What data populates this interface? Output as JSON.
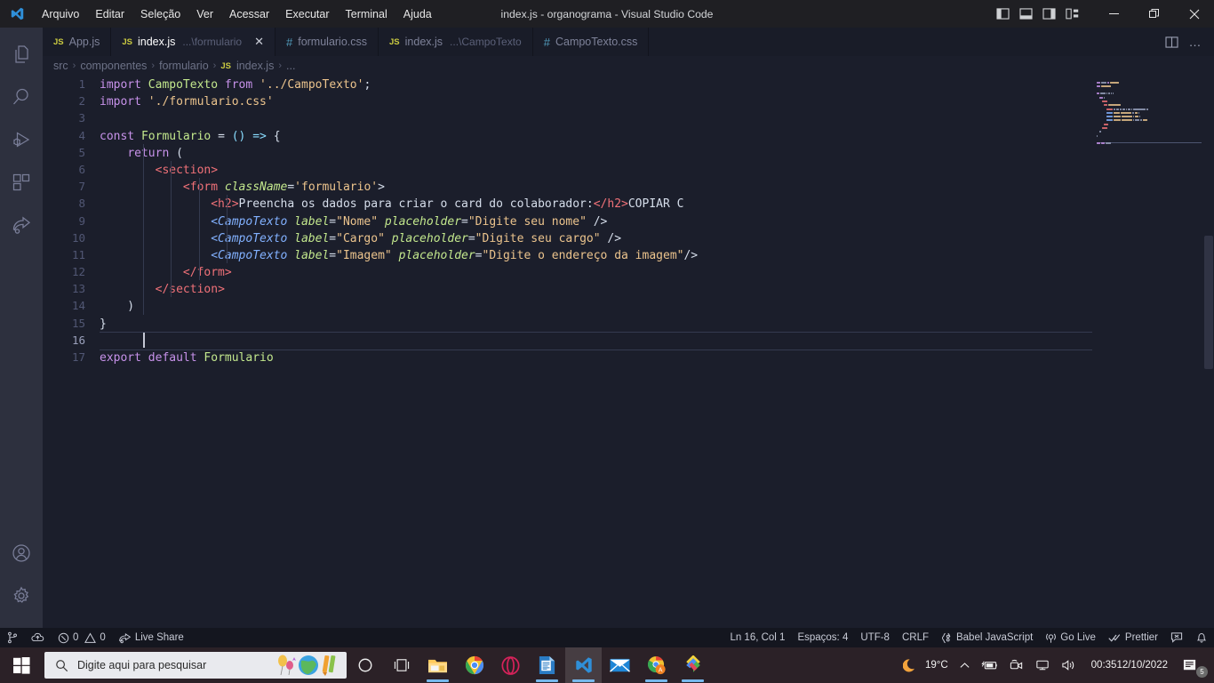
{
  "window": {
    "title": "index.js - organograma - Visual Studio Code",
    "minimize_label": "—",
    "maximize_label": "❐",
    "close_label": "✕"
  },
  "menu": {
    "items": [
      {
        "label": "Arquivo",
        "name": "menu-arquivo"
      },
      {
        "label": "Editar",
        "name": "menu-editar"
      },
      {
        "label": "Seleção",
        "name": "menu-selecao"
      },
      {
        "label": "Ver",
        "name": "menu-ver"
      },
      {
        "label": "Acessar",
        "name": "menu-acessar"
      },
      {
        "label": "Executar",
        "name": "menu-executar"
      },
      {
        "label": "Terminal",
        "name": "menu-terminal"
      },
      {
        "label": "Ajuda",
        "name": "menu-ajuda"
      }
    ]
  },
  "layout_controls": [
    {
      "name": "toggle-primary-sidebar-icon"
    },
    {
      "name": "toggle-panel-icon"
    },
    {
      "name": "toggle-secondary-sidebar-icon"
    },
    {
      "name": "customize-layout-icon"
    }
  ],
  "activity_bar": {
    "items": [
      {
        "name": "explorer-icon",
        "label": "Explorer"
      },
      {
        "name": "search-icon",
        "label": "Pesquisar"
      },
      {
        "name": "run-and-debug-icon",
        "label": "Executar e Depurar"
      },
      {
        "name": "extensions-icon",
        "label": "Extensões"
      },
      {
        "name": "live-share-icon",
        "label": "Live Share"
      }
    ],
    "bottom_items": [
      {
        "name": "account-icon",
        "label": "Conta"
      },
      {
        "name": "settings-gear-icon",
        "label": "Gerenciar"
      }
    ]
  },
  "tabs": [
    {
      "badge": "JS",
      "badge_type": "js",
      "name": "App.js",
      "path": "",
      "active": false,
      "closable": false
    },
    {
      "badge": "JS",
      "badge_type": "js",
      "name": "index.js",
      "path": "...\\formulario",
      "active": true,
      "closable": true,
      "close_label": "✕"
    },
    {
      "badge": "#",
      "badge_type": "css",
      "name": "formulario.css",
      "path": "",
      "active": false,
      "closable": false
    },
    {
      "badge": "JS",
      "badge_type": "js",
      "name": "index.js",
      "path": "...\\CampoTexto",
      "active": false,
      "closable": false
    },
    {
      "badge": "#",
      "badge_type": "css",
      "name": "CampoTexto.css",
      "path": "",
      "active": false,
      "closable": false
    }
  ],
  "editor_actions": {
    "split_editor_icon": "split-editor-icon",
    "more_actions_label": "…"
  },
  "breadcrumb": {
    "separator": "›",
    "badge": "JS",
    "parts": [
      "src",
      "componentes",
      "formulario",
      "index.js",
      "..."
    ]
  },
  "code": {
    "language": "javascript",
    "active_line": 16,
    "lines": [
      {
        "n": 1,
        "text": "import CampoTexto from '../CampoTexto';"
      },
      {
        "n": 2,
        "text": "import './formulario.css'"
      },
      {
        "n": 3,
        "text": ""
      },
      {
        "n": 4,
        "text": "const Formulario = () => {"
      },
      {
        "n": 5,
        "text": "    return ("
      },
      {
        "n": 6,
        "text": "        <section>"
      },
      {
        "n": 7,
        "text": "            <form className='formulario'>"
      },
      {
        "n": 8,
        "text": "                <h2>Preencha os dados para criar o card do colaborador:</h2>COPIAR C"
      },
      {
        "n": 9,
        "text": "                <CampoTexto label=\"Nome\" placeholder=\"Digite seu nome\" />"
      },
      {
        "n": 10,
        "text": "                <CampoTexto label=\"Cargo\" placeholder=\"Digite seu cargo\" />"
      },
      {
        "n": 11,
        "text": "                <CampoTexto label=\"Imagem\" placeholder=\"Digite o endereço da imagem\"/>"
      },
      {
        "n": 12,
        "text": "            </form>"
      },
      {
        "n": 13,
        "text": "        </section>"
      },
      {
        "n": 14,
        "text": "    )"
      },
      {
        "n": 15,
        "text": "}"
      },
      {
        "n": 16,
        "text": ""
      },
      {
        "n": 17,
        "text": "export default Formulario"
      }
    ]
  },
  "status_bar": {
    "left": [
      {
        "name": "source-control-branch-icon",
        "label": ""
      },
      {
        "name": "remote-host-icon",
        "label": ""
      },
      {
        "name": "problems-errors-warnings",
        "errors": "0",
        "warnings": "0"
      },
      {
        "name": "live-share-status",
        "label": "Live Share"
      }
    ],
    "right": [
      {
        "name": "editor-position",
        "label": "Ln 16, Col 1"
      },
      {
        "name": "indentation",
        "label": "Espaços: 4"
      },
      {
        "name": "encoding",
        "label": "UTF-8"
      },
      {
        "name": "eol",
        "label": "CRLF"
      },
      {
        "name": "language-mode",
        "label": "Babel JavaScript"
      },
      {
        "name": "go-live",
        "label": "Go Live"
      },
      {
        "name": "prettier",
        "label": "Prettier"
      },
      {
        "name": "feedback-icon",
        "label": ""
      },
      {
        "name": "notifications-bell-icon",
        "label": ""
      }
    ]
  },
  "taskbar": {
    "start_name": "start-button",
    "search": {
      "placeholder": "Digite aqui para pesquisar",
      "value": ""
    },
    "items": [
      {
        "name": "cortana-icon",
        "running": false
      },
      {
        "name": "task-view-icon",
        "running": false
      },
      {
        "name": "file-explorer-icon",
        "running": true
      },
      {
        "name": "google-chrome-icon",
        "running": false
      },
      {
        "name": "opera-icon",
        "running": false
      },
      {
        "name": "libreoffice-writer-icon",
        "running": true
      },
      {
        "name": "visual-studio-code-icon",
        "running": true,
        "active": true
      },
      {
        "name": "mail-icon",
        "running": false
      },
      {
        "name": "chrome-app-icon",
        "running": true
      },
      {
        "name": "photos-app-icon",
        "running": true
      }
    ],
    "tray": {
      "weather_icon": "moon-icon",
      "weather_temp": "19°C",
      "show_hidden_icons": "∧",
      "icons": [
        {
          "name": "battery-charging-icon"
        },
        {
          "name": "camera-icon"
        },
        {
          "name": "network-icon"
        },
        {
          "name": "volume-icon"
        }
      ],
      "time": "00:35",
      "date": "12/10/2022",
      "notifications": {
        "name": "action-center-icon",
        "count": "5"
      }
    }
  },
  "colors": {
    "titlebar_bg": "#1f1f23",
    "activitybar_bg": "#2d303e",
    "editor_bg": "#1b1e2b",
    "tabbar_bg": "#191c28",
    "statusbar_bg": "#14161f",
    "taskbar_bg": "#2b2127",
    "accent_blue": "#82aaff",
    "keyword_purple": "#c792ea",
    "string_orange": "#ecc48d",
    "variable_green": "#c3e88d",
    "tag_red": "#f07178"
  }
}
